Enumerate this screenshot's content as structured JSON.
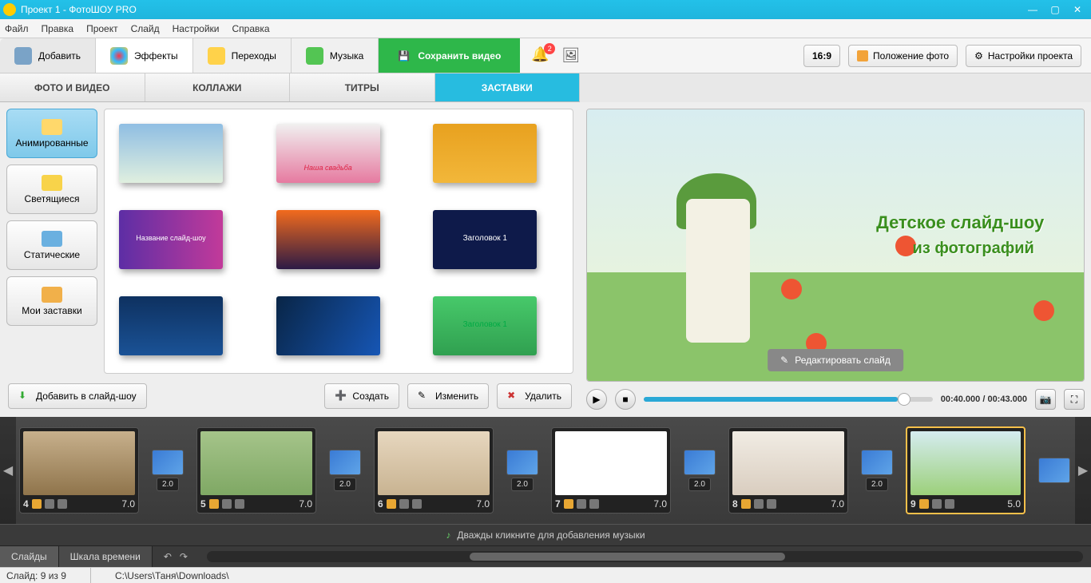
{
  "title": "Проект 1 - ФотоШОУ PRO",
  "menu": [
    "Файл",
    "Правка",
    "Проект",
    "Слайд",
    "Настройки",
    "Справка"
  ],
  "toolbar": {
    "add": "Добавить",
    "effects": "Эффекты",
    "transitions": "Переходы",
    "music": "Музыка",
    "save": "Сохранить видео",
    "badge": "2",
    "ratio": "16:9",
    "photo_pos": "Положение фото",
    "proj_settings": "Настройки проекта"
  },
  "cats": [
    "ФОТО И ВИДЕО",
    "КОЛЛАЖИ",
    "ТИТРЫ",
    "ЗАСТАВКИ"
  ],
  "side": [
    "Анимированные",
    "Светящиеся",
    "Статические",
    "Мои заставки"
  ],
  "gallery": {
    "t0": {
      "bg": "linear-gradient(#8fbee3,#e0efdf)"
    },
    "t1": {
      "bg": "linear-gradient(#f0f0f0,#e67aa0)",
      "txt": "Наша свадьба"
    },
    "t2": {
      "bg": "linear-gradient(#e8a11f,#f2b73a)"
    },
    "t3": {
      "bg": "linear-gradient(90deg,#5d2ea5,#c23a9a)",
      "txt": "Название слайд-шоу"
    },
    "t4": {
      "bg": "linear-gradient(#f26b1d,#2c1a45)"
    },
    "t5": {
      "bg": "#0e1a4a",
      "txt": "Заголовок 1"
    },
    "t6": {
      "bg": "linear-gradient(#0e3160,#1a5296)"
    },
    "t7": {
      "bg": "linear-gradient(120deg,#092546,#1656b5)"
    },
    "t8": {
      "bg": "linear-gradient(#47c96a,#30a050)",
      "txt": "Заголовок 1"
    }
  },
  "left_buttons": {
    "add": "Добавить в слайд-шоу",
    "create": "Создать",
    "edit": "Изменить",
    "delete": "Удалить"
  },
  "preview": {
    "line1": "Детское слайд-шоу",
    "line2": "из фотографий",
    "edit": "Редактировать слайд"
  },
  "player": {
    "time": "00:40.000 / 00:43.000"
  },
  "slides": [
    {
      "n": "4",
      "dur": "7.0",
      "bg": "linear-gradient(#c7b08c,#8f744b)"
    },
    {
      "n": "5",
      "dur": "7.0",
      "bg": "linear-gradient(#a5c48a,#7fa864)"
    },
    {
      "n": "6",
      "dur": "7.0",
      "bg": "linear-gradient(#e7d7bf,#c8b391)"
    },
    {
      "n": "7",
      "dur": "7.0",
      "bg": "#ffffff"
    },
    {
      "n": "8",
      "dur": "7.0",
      "bg": "linear-gradient(#f1ece4,#d9cdbf)"
    },
    {
      "n": "9",
      "dur": "5.0",
      "bg": "linear-gradient(#d5ecf0,#9cd07a)"
    }
  ],
  "trans_dur": "2.0",
  "music_hint": "Дважды кликните для добавления музыки",
  "bottom_tabs": {
    "slides": "Слайды",
    "timeline": "Шкала времени"
  },
  "status": {
    "slide": "Слайд: 9 из 9",
    "path": "C:\\Users\\Таня\\Downloads\\"
  }
}
